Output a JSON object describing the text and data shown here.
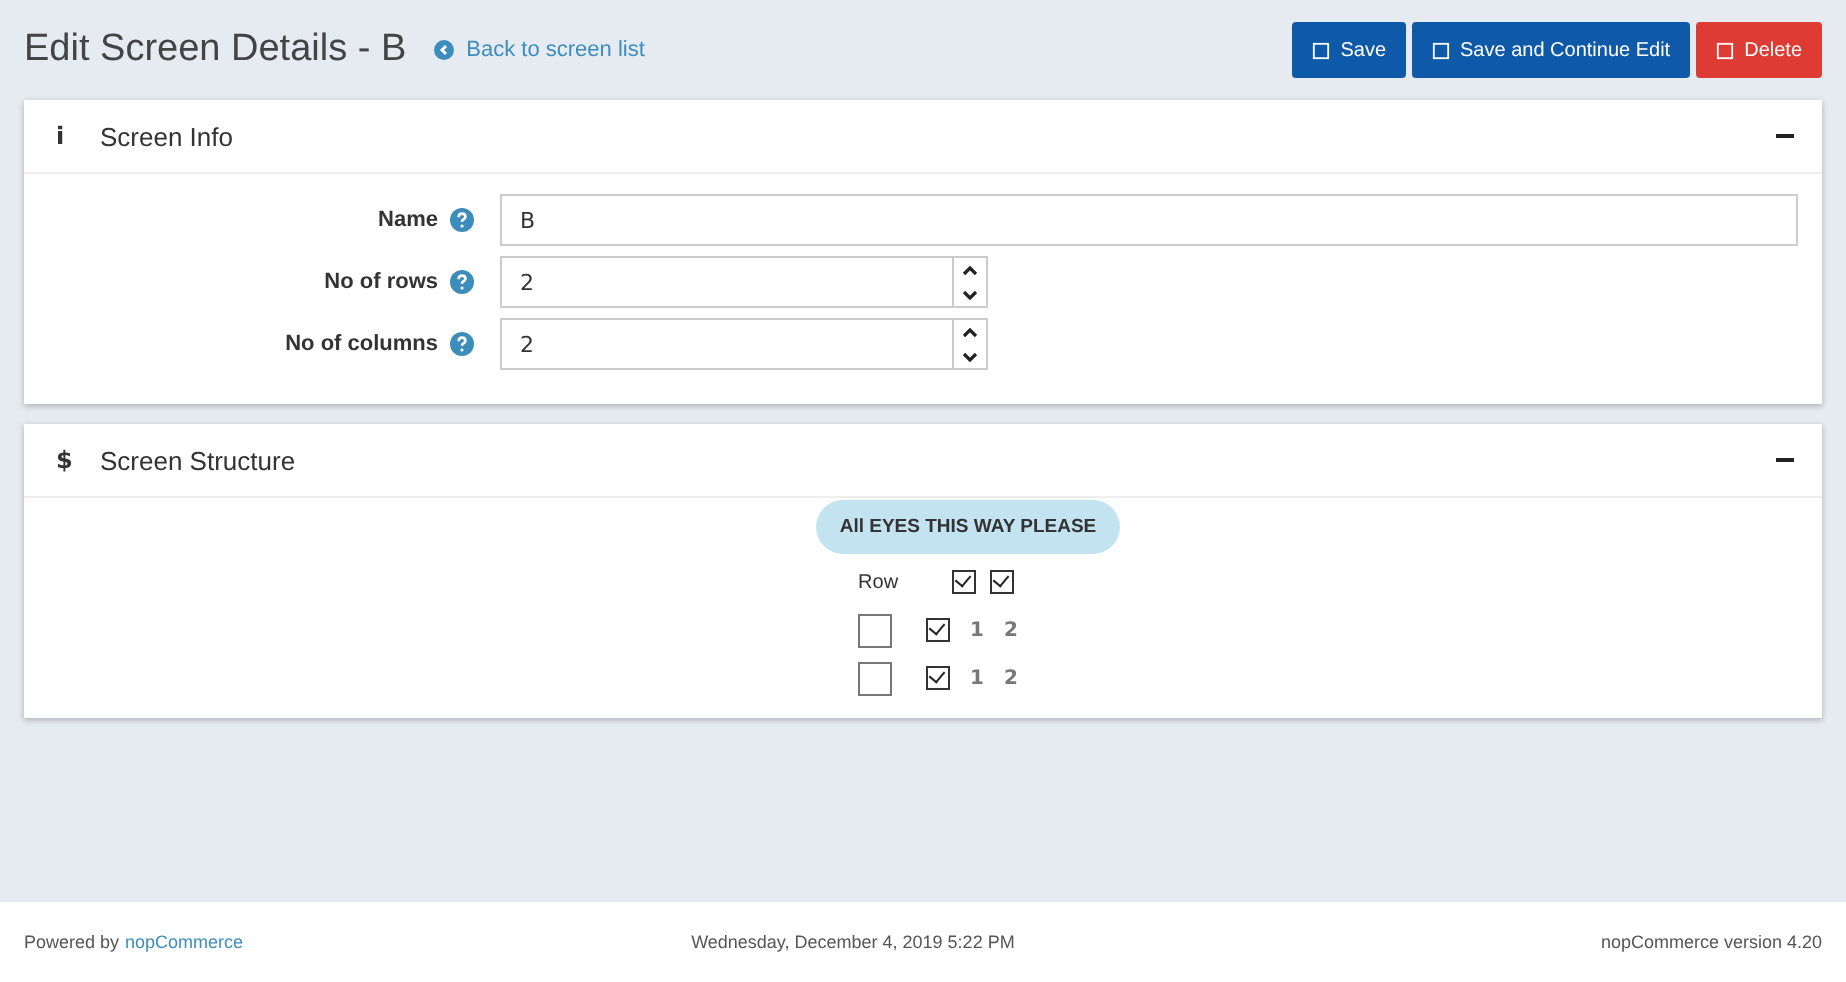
{
  "page_title": "Edit Screen Details - B",
  "back_link": "Back to screen list",
  "buttons": [
    {
      "label": "Save",
      "kind": "primary"
    },
    {
      "label": "Save and Continue Edit",
      "kind": "primary"
    },
    {
      "label": "Delete",
      "kind": "danger"
    }
  ],
  "screen_info": {
    "icon": "i",
    "title": "Screen Info",
    "expanded": true,
    "fields": [
      {
        "label": "Name",
        "value": "B",
        "kind": "text"
      },
      {
        "label": "No of rows",
        "value": "2",
        "kind": "number"
      },
      {
        "label": "No of columns",
        "value": "2",
        "kind": "number"
      }
    ]
  },
  "screen_structure": {
    "icon": "$",
    "title": "Screen Structure",
    "expanded": true,
    "banner": "All EYES THIS WAY PLEASE",
    "row_label": "Row",
    "column_checks": [
      {
        "checked": true
      },
      {
        "checked": true
      }
    ],
    "rows": [
      {
        "selected": false,
        "checked": true,
        "cells": [
          "1",
          "2"
        ]
      },
      {
        "selected": false,
        "checked": true,
        "cells": [
          "1",
          "2"
        ]
      }
    ]
  },
  "footer": {
    "powered_by": "Powered by",
    "powered_link": "nopCommerce",
    "date": "Wednesday, December 4, 2019 5:22 PM",
    "version": "nopCommerce version 4.20"
  }
}
